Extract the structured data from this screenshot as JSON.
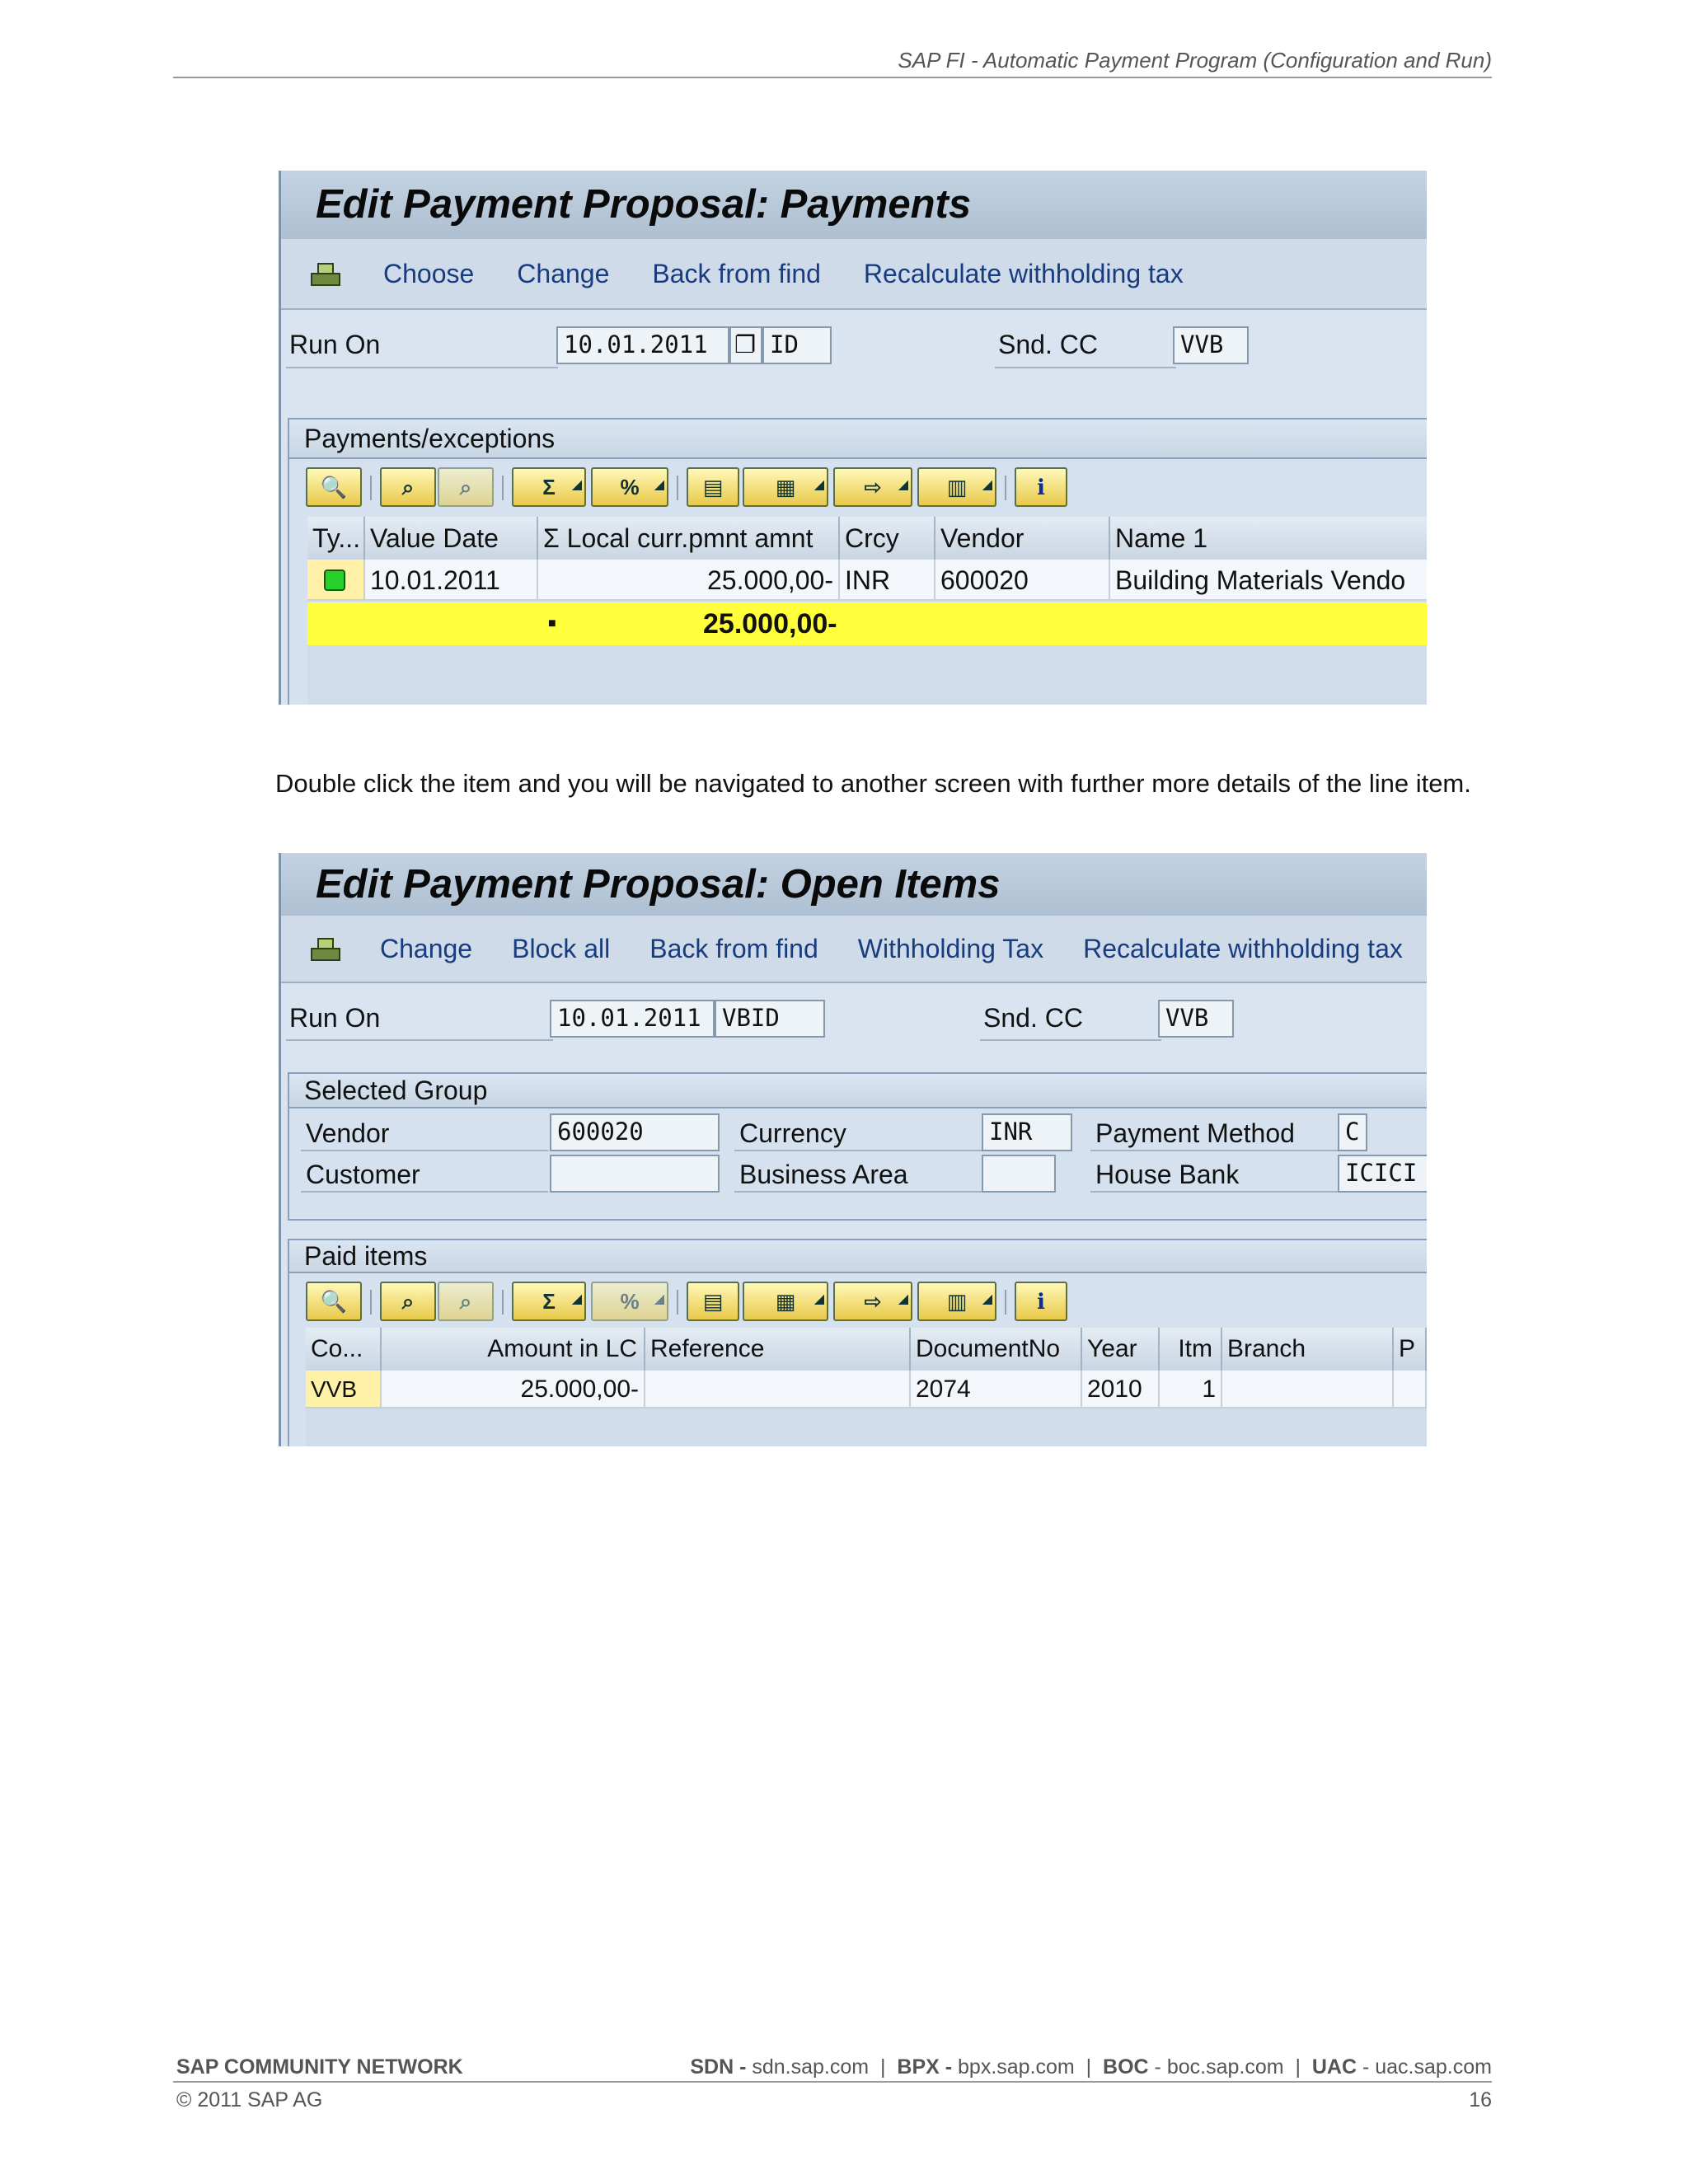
{
  "header": {
    "title": "SAP FI - Automatic Payment Program (Configuration and Run)"
  },
  "screen1": {
    "title": "Edit Payment Proposal: Payments",
    "toolbar": [
      "Choose",
      "Change",
      "Back from find",
      "Recalculate withholding tax"
    ],
    "run_on_label": "Run On",
    "run_on_date": "10.01.2011",
    "run_on_id": "ID",
    "snd_cc_label": "Snd. CC",
    "snd_cc_value": "VVB",
    "group_title": "Payments/exceptions",
    "columns": [
      "Ty...",
      "Value Date",
      "Σ Local curr.pmnt amnt",
      "Crcy",
      "Vendor",
      "Name 1"
    ],
    "rows": [
      {
        "status": "green",
        "value_date": "10.01.2011",
        "amount": "25.000,00-",
        "currency": "INR",
        "vendor": "600020",
        "name": "Building Materials Vendo"
      }
    ],
    "total_marker": "■",
    "total": "25.000,00-"
  },
  "instruction": "Double click the item and you will be navigated to another screen  with further more details of the line item.",
  "screen2": {
    "title": "Edit Payment Proposal: Open Items",
    "toolbar": [
      "Change",
      "Block all",
      "Back from find",
      "Withholding Tax",
      "Recalculate withholding tax"
    ],
    "run_on_label": "Run On",
    "run_on_date": "10.01.2011",
    "run_on_id": "VBID",
    "snd_cc_label": "Snd. CC",
    "snd_cc_value": "VVB",
    "selected_group": {
      "title": "Selected Group",
      "vendor_label": "Vendor",
      "vendor_value": "600020",
      "customer_label": "Customer",
      "customer_value": "",
      "currency_label": "Currency",
      "currency_value": "INR",
      "business_area_label": "Business Area",
      "business_area_value": "",
      "payment_method_label": "Payment Method",
      "payment_method_value": "C",
      "house_bank_label": "House Bank",
      "house_bank_value": "ICICI"
    },
    "paid_items": {
      "title": "Paid items",
      "columns": [
        "Co...",
        "Amount in LC",
        "Reference",
        "DocumentNo",
        "Year",
        "Itm",
        "Branch",
        "P"
      ],
      "rows": [
        {
          "company": "VVB",
          "amount": "25.000,00-",
          "reference": "",
          "document_no": "2074",
          "year": "2010",
          "item": "1",
          "branch": "",
          "p": ""
        }
      ]
    }
  },
  "footer": {
    "network": "SAP COMMUNITY NETWORK",
    "links": [
      {
        "label": "SDN",
        "url": "sdn.sap.com"
      },
      {
        "label": "BPX",
        "url": "bpx.sap.com"
      },
      {
        "label": "BOC",
        "url": "boc.sap.com"
      },
      {
        "label": "UAC",
        "url": "uac.sap.com"
      }
    ],
    "copyright": "© 2011 SAP AG",
    "page": "16"
  }
}
